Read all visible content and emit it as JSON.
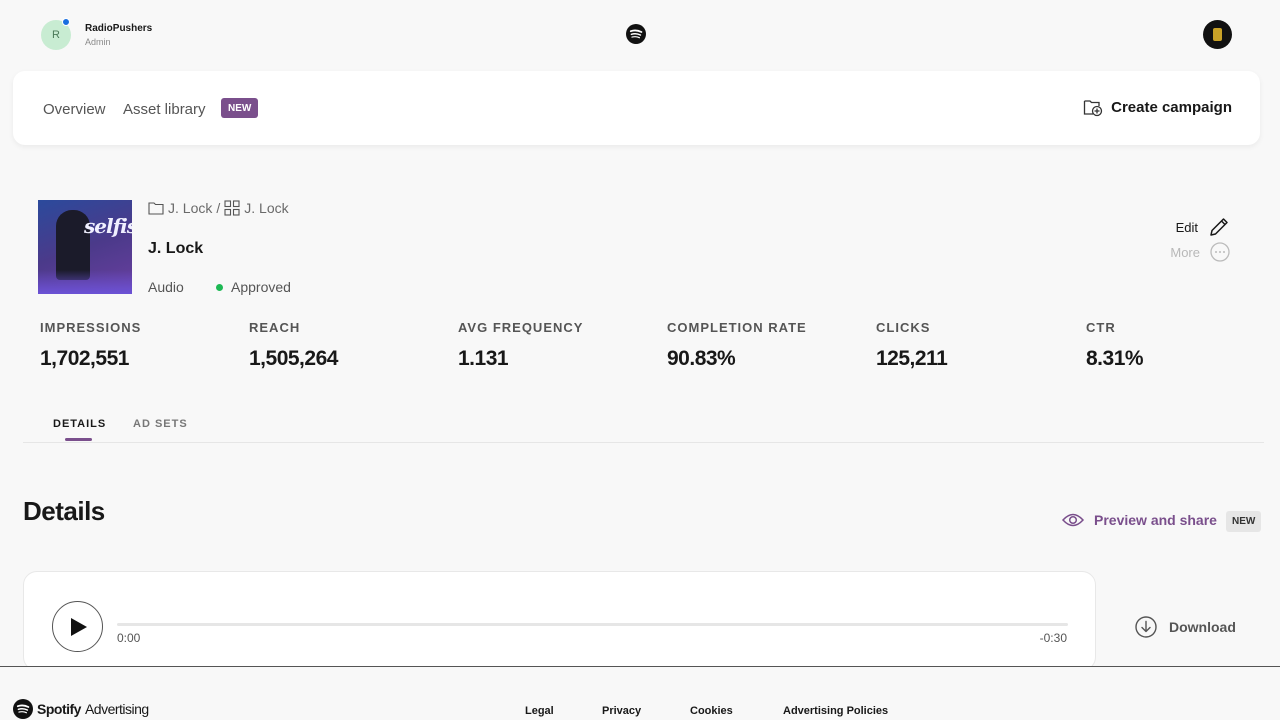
{
  "account": {
    "initial": "R",
    "name": "RadioPushers",
    "role": "Admin"
  },
  "nav": {
    "overview": "Overview",
    "asset_library": "Asset library",
    "asset_library_badge": "NEW",
    "create_campaign": "Create campaign"
  },
  "campaign": {
    "breadcrumb_folder": "J. Lock",
    "breadcrumb_separator": "/",
    "breadcrumb_grid": "J. Lock",
    "title": "J. Lock",
    "type": "Audio",
    "status": "Approved",
    "cover_text": "selfish",
    "edit_label": "Edit",
    "more_label": "More"
  },
  "metrics": [
    {
      "label": "IMPRESSIONS",
      "value": "1,702,551"
    },
    {
      "label": "REACH",
      "value": "1,505,264"
    },
    {
      "label": "AVG FREQUENCY",
      "value": "1.131"
    },
    {
      "label": "COMPLETION RATE",
      "value": "90.83%"
    },
    {
      "label": "CLICKS",
      "value": "125,211"
    },
    {
      "label": "CTR",
      "value": "8.31%"
    }
  ],
  "tabs": {
    "details": "DETAILS",
    "ad_sets": "AD SETS"
  },
  "details": {
    "heading": "Details",
    "preview_share": "Preview and share",
    "preview_badge": "NEW"
  },
  "player": {
    "time_current": "0:00",
    "time_remaining": "-0:30",
    "progress": 0
  },
  "download_label": "Download",
  "footer": {
    "brand": "Spotify",
    "brand_sub": "Advertising",
    "links": [
      "Legal",
      "Privacy",
      "Cookies",
      "Advertising Policies"
    ]
  },
  "colors": {
    "accent": "#7a4f8c",
    "approved": "#1db954",
    "notification": "#1a6fe0"
  }
}
